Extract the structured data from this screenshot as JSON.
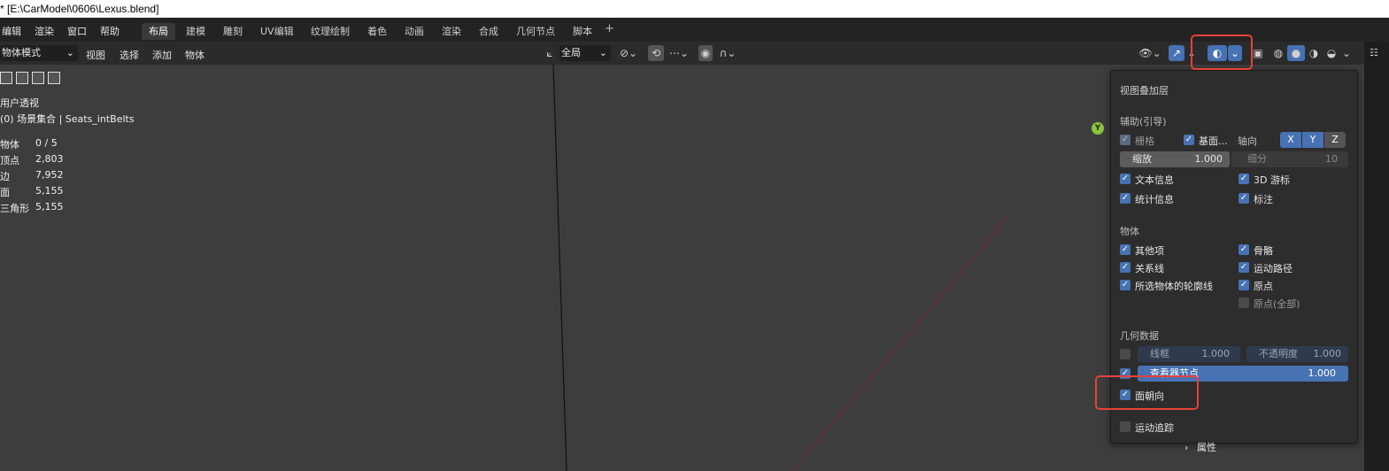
{
  "window": {
    "title": "* [E:\\CarModel\\0606\\Lexus.blend]"
  },
  "menubar": {
    "items": [
      "编辑",
      "渲染",
      "窗口",
      "帮助"
    ],
    "workspaces": [
      "布局",
      "建模",
      "雕刻",
      "UV编辑",
      "纹理绘制",
      "着色",
      "动画",
      "渲染",
      "合成",
      "几何节点",
      "脚本"
    ],
    "active_workspace": "布局"
  },
  "header": {
    "mode": "物体模式",
    "menus": [
      "视图",
      "选择",
      "添加",
      "物体"
    ],
    "orientation": "全局"
  },
  "overlay_info": {
    "view_name": "用户透视",
    "collection": "(0) 场景集合 | Seats_intBelts",
    "stats": [
      {
        "label": "物体",
        "value": "0 / 5"
      },
      {
        "label": "顶点",
        "value": "2,803"
      },
      {
        "label": "边",
        "value": "7,952"
      },
      {
        "label": "面",
        "value": "5,155"
      },
      {
        "label": "三角形",
        "value": "5,155"
      }
    ]
  },
  "popup": {
    "title": "视图叠加层",
    "guides": {
      "section": "辅助(引导)",
      "grid": "栅格",
      "floor": "基面...",
      "axes_label": "轴向",
      "axes": [
        "X",
        "Y",
        "Z"
      ],
      "scale_label": "缩放",
      "scale_value": "1.000",
      "subdiv_label": "细分",
      "subdiv_value": "10",
      "text_info": "文本信息",
      "cursor3d": "3D 游标",
      "stats": "统计信息",
      "annotations": "标注"
    },
    "objects": {
      "section": "物体",
      "extras": "其他项",
      "bones": "骨骼",
      "relations": "关系线",
      "motion_paths": "运动路径",
      "outline": "所选物体的轮廓线",
      "origins": "原点",
      "origins_all": "原点(全部)"
    },
    "geometry": {
      "section": "几何数据",
      "wireframe_label": "线框",
      "wireframe_value": "1.000",
      "opacity_label": "不透明度",
      "opacity_value": "1.000",
      "viewer_label": "查看器节点",
      "viewer_value": "1.000",
      "face_orientation": "面朝向"
    },
    "motion_tracking": "运动追踪"
  },
  "properties": {
    "row_label": "属性"
  },
  "gizmo": {
    "y_label": "Y"
  },
  "colors": {
    "accent": "#4772b3",
    "highlight_box": "#e8403a",
    "background": "#3d3d3d"
  }
}
